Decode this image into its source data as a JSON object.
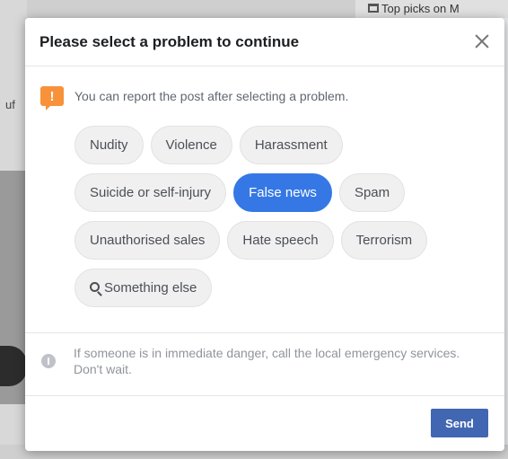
{
  "background": {
    "left_text": "uf",
    "right_text": "Top picks on M"
  },
  "dialog": {
    "title": "Please select a problem to continue",
    "close_label": "",
    "notice": {
      "icon": "warning-icon",
      "icon_glyph": "!",
      "text": "You can report the post after selecting a problem."
    },
    "problems": [
      [
        "Nudity",
        "Violence",
        "Harassment"
      ],
      [
        "Suicide or self-injury",
        "False news",
        "Spam"
      ],
      [
        "Unauthorised sales",
        "Hate speech",
        "Terrorism"
      ],
      [
        "Something else"
      ]
    ],
    "selected_problem": "False news",
    "emergency_text": "If someone is in immediate danger, call the local emergency services. Don't wait.",
    "send_label": "Send"
  },
  "colors": {
    "selected_chip": "#3578e5",
    "send_button": "#4267b2",
    "warning": "#f7923a"
  }
}
